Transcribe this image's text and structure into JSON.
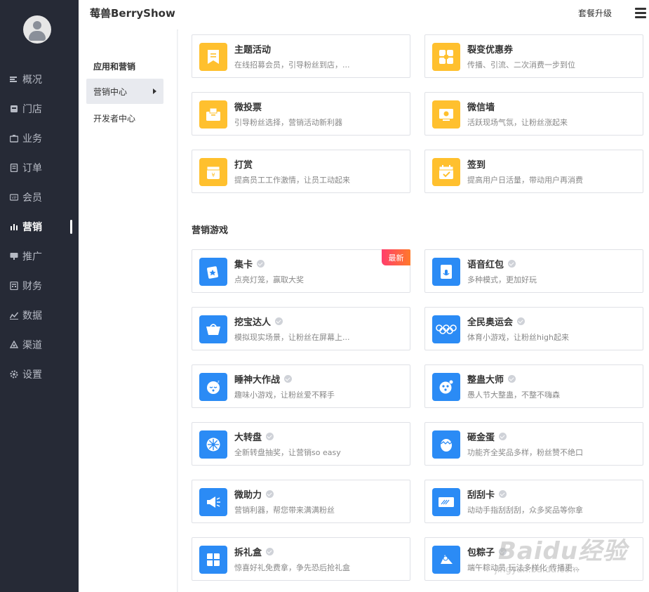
{
  "sidebar": {
    "items": [
      {
        "label": "概况",
        "icon": "overview-icon"
      },
      {
        "label": "门店",
        "icon": "store-icon"
      },
      {
        "label": "业务",
        "icon": "briefcase-icon"
      },
      {
        "label": "订单",
        "icon": "order-icon"
      },
      {
        "label": "会员",
        "icon": "vip-icon"
      },
      {
        "label": "营销",
        "icon": "bar-chart-icon"
      },
      {
        "label": "推广",
        "icon": "promote-icon"
      },
      {
        "label": "财务",
        "icon": "finance-icon"
      },
      {
        "label": "数据",
        "icon": "data-icon"
      },
      {
        "label": "渠道",
        "icon": "channel-icon"
      },
      {
        "label": "设置",
        "icon": "gear-icon"
      }
    ]
  },
  "header": {
    "brand": "莓兽BerryShow",
    "upgrade": "套餐升级"
  },
  "subnav": {
    "title": "应用和营销",
    "items": [
      {
        "label": "营销中心"
      },
      {
        "label": "开发者中心"
      }
    ]
  },
  "main": {
    "apps": [
      {
        "title": "主题活动",
        "desc": "在线招募会员，引导粉丝到店，...",
        "color": "#ffc02e",
        "icon": "bookmark-icon"
      },
      {
        "title": "裂变优惠券",
        "desc": "传播、引流、二次消费一步到位",
        "color": "#ffc02e",
        "icon": "coupon-icon"
      },
      {
        "title": "微投票",
        "desc": "引导粉丝选择，营销活动新利器",
        "color": "#ffc02e",
        "icon": "ballot-icon"
      },
      {
        "title": "微信墙",
        "desc": "活跃现场气氛，让粉丝涨起来",
        "color": "#ffc02e",
        "icon": "screen-icon"
      },
      {
        "title": "打赏",
        "desc": "提高员工工作激情，让员工动起来",
        "color": "#ffc02e",
        "icon": "reward-icon"
      },
      {
        "title": "签到",
        "desc": "提高用户日活量，带动用户再消费",
        "color": "#ffc02e",
        "icon": "calendar-check-icon"
      }
    ],
    "games_title": "营销游戏",
    "games": [
      {
        "title": "集卡",
        "desc": "点亮灯笼，赢取大奖",
        "badge": "最新",
        "icon": "cards-icon"
      },
      {
        "title": "语音红包",
        "desc": "多种模式，更加好玩",
        "icon": "voice-envelope-icon"
      },
      {
        "title": "挖宝达人",
        "desc": "模拟现实场景，让粉丝在屏幕上...",
        "icon": "treasure-icon"
      },
      {
        "title": "全民奥运会",
        "desc": "体育小游戏，让粉丝high起来",
        "icon": "olympic-rings-icon"
      },
      {
        "title": "睡神大作战",
        "desc": "趣味小游戏，让粉丝爱不释手",
        "icon": "sleepy-face-icon"
      },
      {
        "title": "整蛊大师",
        "desc": "愚人节大整蛊，不整不嗨森",
        "icon": "prank-icon"
      },
      {
        "title": "大转盘",
        "desc": "全新转盘抽奖，让营销so easy",
        "icon": "wheel-icon"
      },
      {
        "title": "砸金蛋",
        "desc": "功能齐全奖品多样，粉丝赞不绝口",
        "icon": "golden-egg-icon"
      },
      {
        "title": "微助力",
        "desc": "营销利器，帮您带来满满粉丝",
        "icon": "megaphone-icon"
      },
      {
        "title": "刮刮卡",
        "desc": "动动手指刮刮刮，众多奖品等你拿",
        "icon": "scratch-card-icon"
      },
      {
        "title": "拆礼盒",
        "desc": "惊喜好礼免费拿，争先恐后抢礼盒",
        "icon": "gift-box-icon"
      },
      {
        "title": "包粽子",
        "desc": "端午粽动员 玩法多样化 传播更...",
        "icon": "zongzi-icon"
      }
    ]
  },
  "watermark": {
    "text": "Baidu经验",
    "sub": "jingyan.baidu.com"
  },
  "colors": {
    "sidebar_bg": "#262a36",
    "orange": "#ffc02e",
    "blue": "#2b8bf5",
    "badge_from": "#ff3e6c",
    "badge_to": "#ff7a2b"
  }
}
